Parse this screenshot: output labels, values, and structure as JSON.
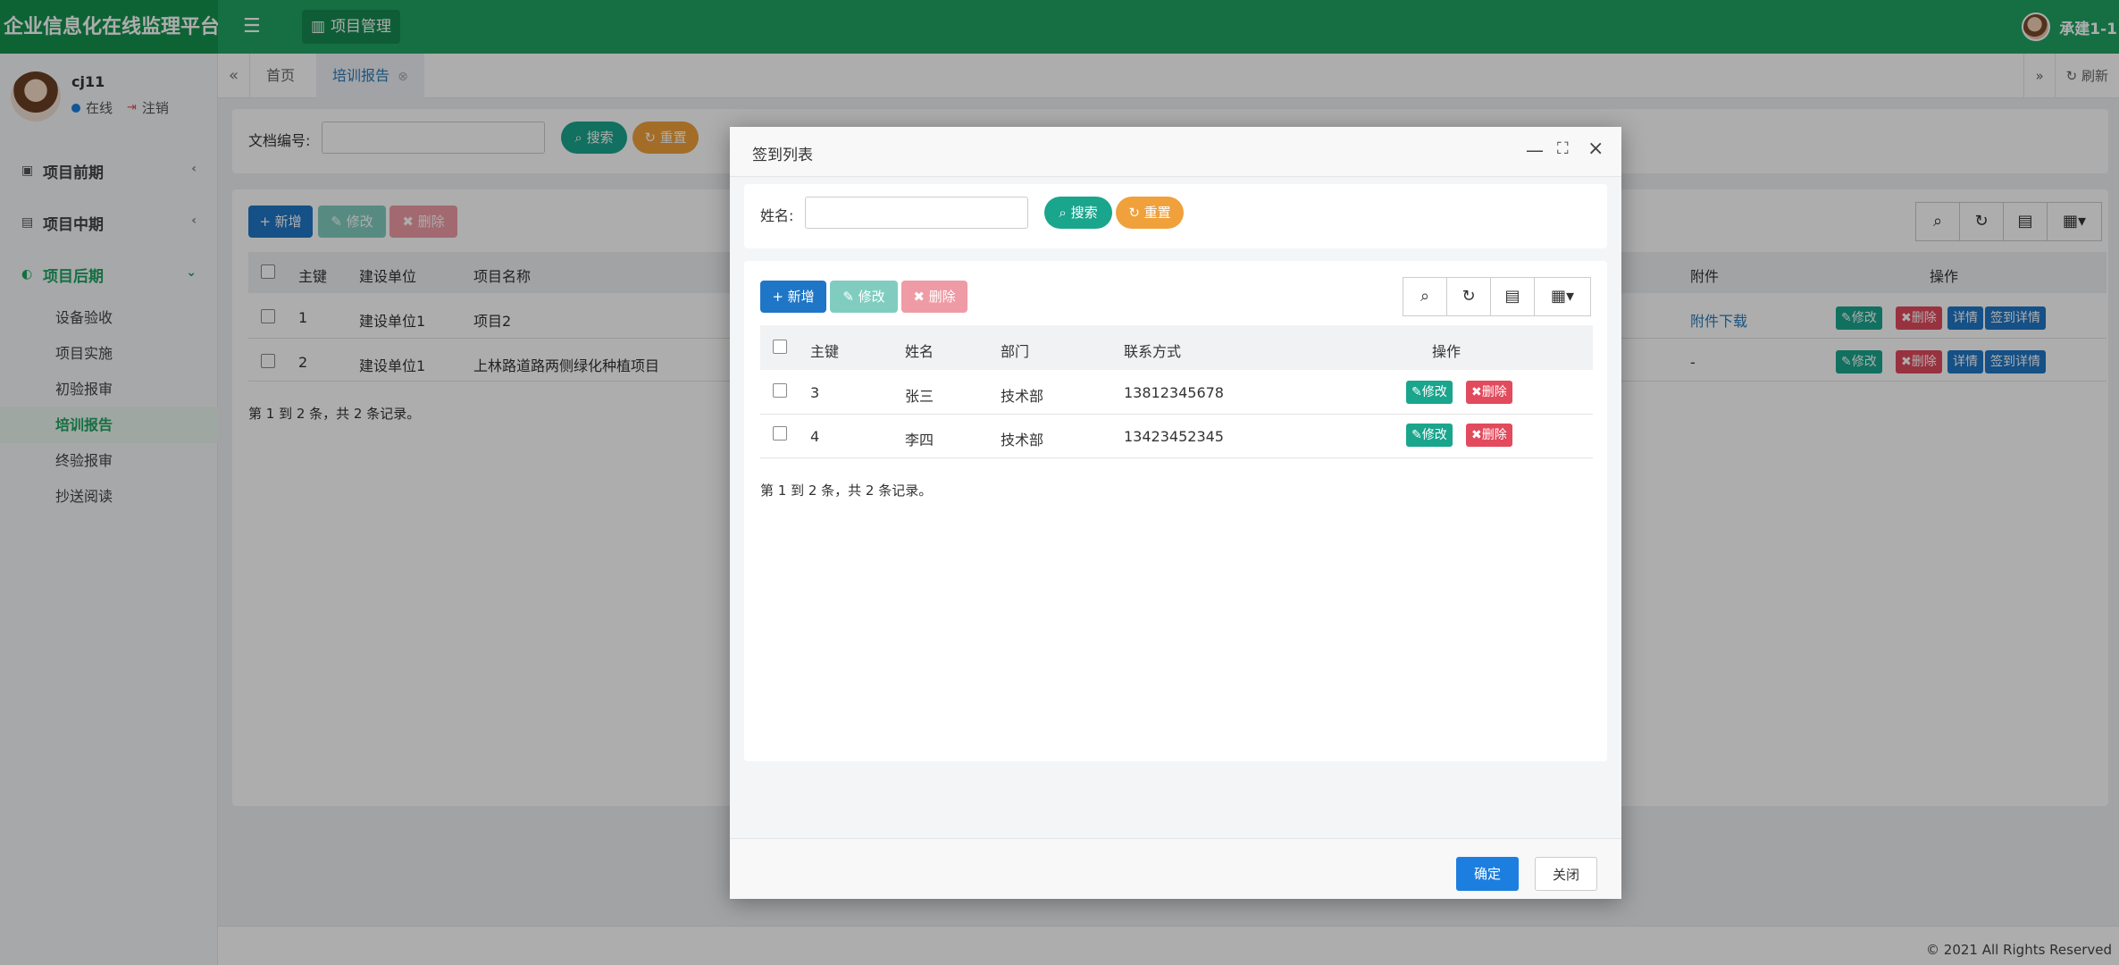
{
  "app": {
    "brand": "企业信息化在线监理平台",
    "top_menu": "项目管理",
    "user": "承建1-1"
  },
  "profile": {
    "name": "cj11",
    "status": "在线",
    "logout": "注销"
  },
  "sidebar": {
    "groups": [
      {
        "label": "项目前期"
      },
      {
        "label": "项目中期"
      },
      {
        "label": "项目后期"
      }
    ],
    "subitems": [
      {
        "label": "设备验收"
      },
      {
        "label": "项目实施"
      },
      {
        "label": "初验报审"
      },
      {
        "label": "培训报告"
      },
      {
        "label": "终验报审"
      },
      {
        "label": "抄送阅读"
      }
    ]
  },
  "tabs": [
    {
      "label": "首页"
    },
    {
      "label": "培训报告"
    }
  ],
  "tabbar": {
    "refresh": "刷新"
  },
  "search": {
    "label": "文档编号:",
    "search": "搜索",
    "reset": "重置"
  },
  "toolbar": {
    "add": "新增",
    "edit": "修改",
    "del": "删除"
  },
  "table": {
    "headers": {
      "id": "主键",
      "unit": "建设单位",
      "name": "项目名称",
      "attach": "附件",
      "ops": "操作"
    },
    "rows": [
      {
        "id": "1",
        "unit": "建设单位1",
        "name": "项目2",
        "attach": "附件下载"
      },
      {
        "id": "2",
        "unit": "建设单位1",
        "name": "上林路道路两侧绿化种植项目",
        "attach": "-"
      }
    ],
    "row_actions": {
      "edit": "修改",
      "del": "删除",
      "detail": "详情",
      "sign": "签到详情"
    },
    "summary": "第 1 到 2 条，共 2 条记录。"
  },
  "modal": {
    "title": "签到列表",
    "search_label": "姓名:",
    "search": "搜索",
    "reset": "重置",
    "add": "新增",
    "edit": "修改",
    "del": "删除",
    "headers": {
      "id": "主键",
      "name": "姓名",
      "dept": "部门",
      "contact": "联系方式",
      "ops": "操作"
    },
    "rows": [
      {
        "id": "3",
        "name": "张三",
        "dept": "技术部",
        "contact": "13812345678"
      },
      {
        "id": "4",
        "name": "李四",
        "dept": "技术部",
        "contact": "13423452345"
      }
    ],
    "row_edit": "修改",
    "row_del": "删除",
    "summary": "第 1 到 2 条，共 2 条记录。",
    "confirm": "确定",
    "close": "关闭"
  },
  "footer": "© 2021 All Rights Reserved"
}
